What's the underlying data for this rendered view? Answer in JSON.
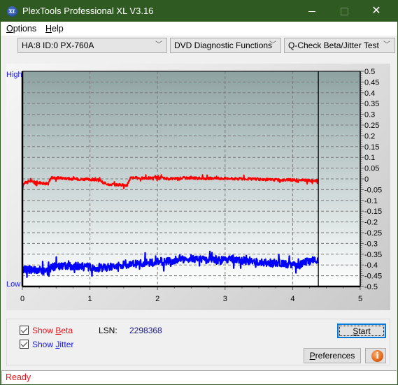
{
  "window": {
    "title": "PlexTools Professional XL V3.16",
    "icon": "xl-app-icon",
    "icon_text": "XL",
    "controls": {
      "minimize": "minimize-icon",
      "maximize": "maximize-icon",
      "close_glyph": "✕"
    }
  },
  "menu": {
    "items": [
      {
        "label": "Options",
        "accel": "O",
        "rest": "ptions"
      },
      {
        "label": "Help",
        "accel": "H",
        "rest": "elp"
      }
    ]
  },
  "toolbar": {
    "drive_select": "HA:8 ID:0  PX-760A",
    "function_select": "DVD Diagnostic Functions",
    "test_select": "Q-Check Beta/Jitter Test",
    "chevron": "﹀"
  },
  "chart_data": {
    "type": "line",
    "title": "",
    "xlabel": "",
    "ylabel": "",
    "left_axis_labels": {
      "high": "High",
      "low": "Low"
    },
    "xlim": [
      0,
      5
    ],
    "ylim": [
      -0.5,
      0.5
    ],
    "x_ticks": [
      "0",
      "1",
      "2",
      "3",
      "4",
      "5"
    ],
    "y_ticks": [
      "0.5",
      "0.45",
      "0.4",
      "0.35",
      "0.3",
      "0.25",
      "0.2",
      "0.15",
      "0.1",
      "0.05",
      "0",
      "-0.05",
      "-0.1",
      "-0.15",
      "-0.2",
      "-0.25",
      "-0.3",
      "-0.35",
      "-0.4",
      "-0.45",
      "-0.5"
    ],
    "grid": true,
    "marker_x": 4.38,
    "series": [
      {
        "name": "Beta",
        "color": "#ff0000",
        "x": [
          0.0,
          0.02,
          0.1,
          0.2,
          0.3,
          0.38,
          0.42,
          0.6,
          0.8,
          1.0,
          1.15,
          1.2,
          1.3,
          1.45,
          1.55,
          1.6,
          1.8,
          2.0,
          2.2,
          2.4,
          2.6,
          2.8,
          3.0,
          3.2,
          3.4,
          3.6,
          3.8,
          4.0,
          4.2,
          4.35,
          4.38
        ],
        "values": [
          -0.04,
          -0.02,
          -0.01,
          -0.015,
          -0.02,
          -0.025,
          0.005,
          0.003,
          0.0,
          -0.003,
          -0.005,
          -0.02,
          -0.025,
          -0.028,
          -0.03,
          0.005,
          0.003,
          0.005,
          0.0,
          0.005,
          0.003,
          0.002,
          0.002,
          0.0,
          0.0,
          -0.003,
          -0.005,
          -0.005,
          -0.007,
          -0.01,
          -0.012
        ]
      },
      {
        "name": "Jitter",
        "color": "#0000ff",
        "x": [
          0.0,
          0.02,
          0.2,
          0.4,
          0.42,
          0.6,
          0.8,
          1.0,
          1.15,
          1.3,
          1.5,
          1.7,
          1.9,
          2.1,
          2.3,
          2.5,
          2.7,
          2.9,
          3.1,
          3.3,
          3.5,
          3.7,
          3.9,
          4.1,
          4.2,
          4.3,
          4.38
        ],
        "values": [
          -0.43,
          -0.42,
          -0.425,
          -0.425,
          -0.41,
          -0.405,
          -0.405,
          -0.41,
          -0.415,
          -0.41,
          -0.4,
          -0.395,
          -0.39,
          -0.385,
          -0.375,
          -0.37,
          -0.375,
          -0.38,
          -0.375,
          -0.38,
          -0.385,
          -0.39,
          -0.395,
          -0.4,
          -0.385,
          -0.38,
          -0.385
        ]
      }
    ]
  },
  "controls": {
    "show_beta": {
      "label_pre": "Show ",
      "accel": "B",
      "label_post": "eta",
      "checked": true,
      "color": "#e8141b"
    },
    "show_jitter": {
      "label_pre": "Show ",
      "accel": "J",
      "label_post": "itter",
      "checked": true,
      "color": "#1a1ae6"
    },
    "lsn_label": "LSN:",
    "lsn_value": "2298368",
    "start_button": {
      "accel": "S",
      "rest": "tart"
    },
    "preferences_button": {
      "accel": "P",
      "rest": "references"
    },
    "info_button_glyph": "i"
  },
  "status": {
    "text": "Ready"
  }
}
